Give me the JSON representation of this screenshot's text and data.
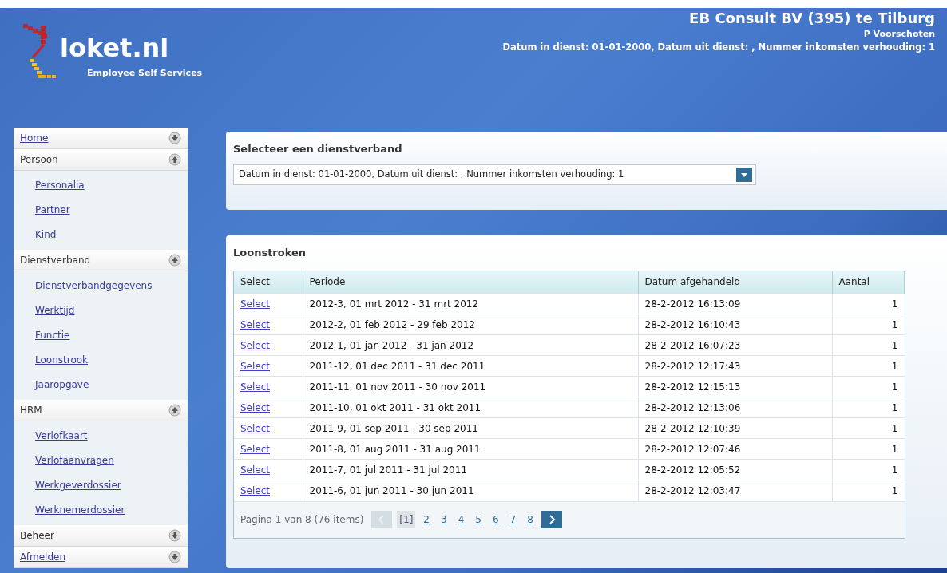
{
  "header": {
    "logo_text": "loket.nl",
    "logo_subtitle": "Employee Self Services",
    "company": "EB Consult BV (395) te Tilburg",
    "user": "P Voorschoten",
    "employment": "Datum in dienst: 01-01-2000, Datum uit dienst: , Nummer inkomsten verhouding: 1"
  },
  "sidebar": {
    "items": [
      {
        "label": "Home",
        "kind": "link",
        "expanded": false
      },
      {
        "label": "Persoon",
        "kind": "group",
        "expanded": true,
        "children": [
          {
            "label": "Personalia"
          },
          {
            "label": "Partner"
          },
          {
            "label": "Kind"
          }
        ]
      },
      {
        "label": "Dienstverband",
        "kind": "group",
        "expanded": true,
        "children": [
          {
            "label": "Dienstverbandgegevens"
          },
          {
            "label": "Werktijd"
          },
          {
            "label": "Functie"
          },
          {
            "label": "Loonstrook"
          },
          {
            "label": "Jaaropgave"
          }
        ]
      },
      {
        "label": "HRM",
        "kind": "group",
        "expanded": true,
        "children": [
          {
            "label": "Verlofkaart"
          },
          {
            "label": "Verlofaanvragen"
          },
          {
            "label": "Werkgeverdossier"
          },
          {
            "label": "Werknemerdossier"
          }
        ]
      },
      {
        "label": "Beheer",
        "kind": "group",
        "expanded": false
      },
      {
        "label": "Afmelden",
        "kind": "link",
        "expanded": false
      }
    ]
  },
  "employment_panel": {
    "title": "Selecteer een dienstverband",
    "select_value": "Datum in dienst: 01-01-2000, Datum uit dienst: , Nummer inkomsten verhouding: 1"
  },
  "payslips_panel": {
    "title": "Loonstroken",
    "table": {
      "columns": [
        "Select",
        "Periode",
        "Datum afgehandeld",
        "Aantal"
      ],
      "rows": [
        {
          "link": "Select",
          "period": "2012-3, 01 mrt 2012 - 31 mrt 2012",
          "processed": "28-2-2012 16:13:09",
          "count": "1"
        },
        {
          "link": "Select",
          "period": "2012-2, 01 feb 2012 - 29 feb 2012",
          "processed": "28-2-2012 16:10:43",
          "count": "1"
        },
        {
          "link": "Select",
          "period": "2012-1, 01 jan 2012 - 31 jan 2012",
          "processed": "28-2-2012 16:07:23",
          "count": "1"
        },
        {
          "link": "Select",
          "period": "2011-12, 01 dec 2011 - 31 dec 2011",
          "processed": "28-2-2012 12:17:43",
          "count": "1"
        },
        {
          "link": "Select",
          "period": "2011-11, 01 nov 2011 - 30 nov 2011",
          "processed": "28-2-2012 12:15:13",
          "count": "1"
        },
        {
          "link": "Select",
          "period": "2011-10, 01 okt 2011 - 31 okt 2011",
          "processed": "28-2-2012 12:13:06",
          "count": "1"
        },
        {
          "link": "Select",
          "period": "2011-9, 01 sep 2011 - 30 sep 2011",
          "processed": "28-2-2012 12:10:39",
          "count": "1"
        },
        {
          "link": "Select",
          "period": "2011-8, 01 aug 2011 - 31 aug 2011",
          "processed": "28-2-2012 12:07:46",
          "count": "1"
        },
        {
          "link": "Select",
          "period": "2011-7, 01 jul 2011 - 31 jul 2011",
          "processed": "28-2-2012 12:05:52",
          "count": "1"
        },
        {
          "link": "Select",
          "period": "2011-6, 01 jun 2011 - 30 jun 2011",
          "processed": "28-2-2012 12:03:47",
          "count": "1"
        }
      ]
    },
    "pager": {
      "summary": "Pagina 1 van 8 (76 items)",
      "prev_disabled": true,
      "next_disabled": false,
      "pages": [
        {
          "label": "[1]",
          "selected": true
        },
        {
          "label": "2",
          "selected": false
        },
        {
          "label": "3",
          "selected": false
        },
        {
          "label": "4",
          "selected": false
        },
        {
          "label": "5",
          "selected": false
        },
        {
          "label": "6",
          "selected": false
        },
        {
          "label": "7",
          "selected": false
        },
        {
          "label": "8",
          "selected": false
        }
      ]
    }
  }
}
